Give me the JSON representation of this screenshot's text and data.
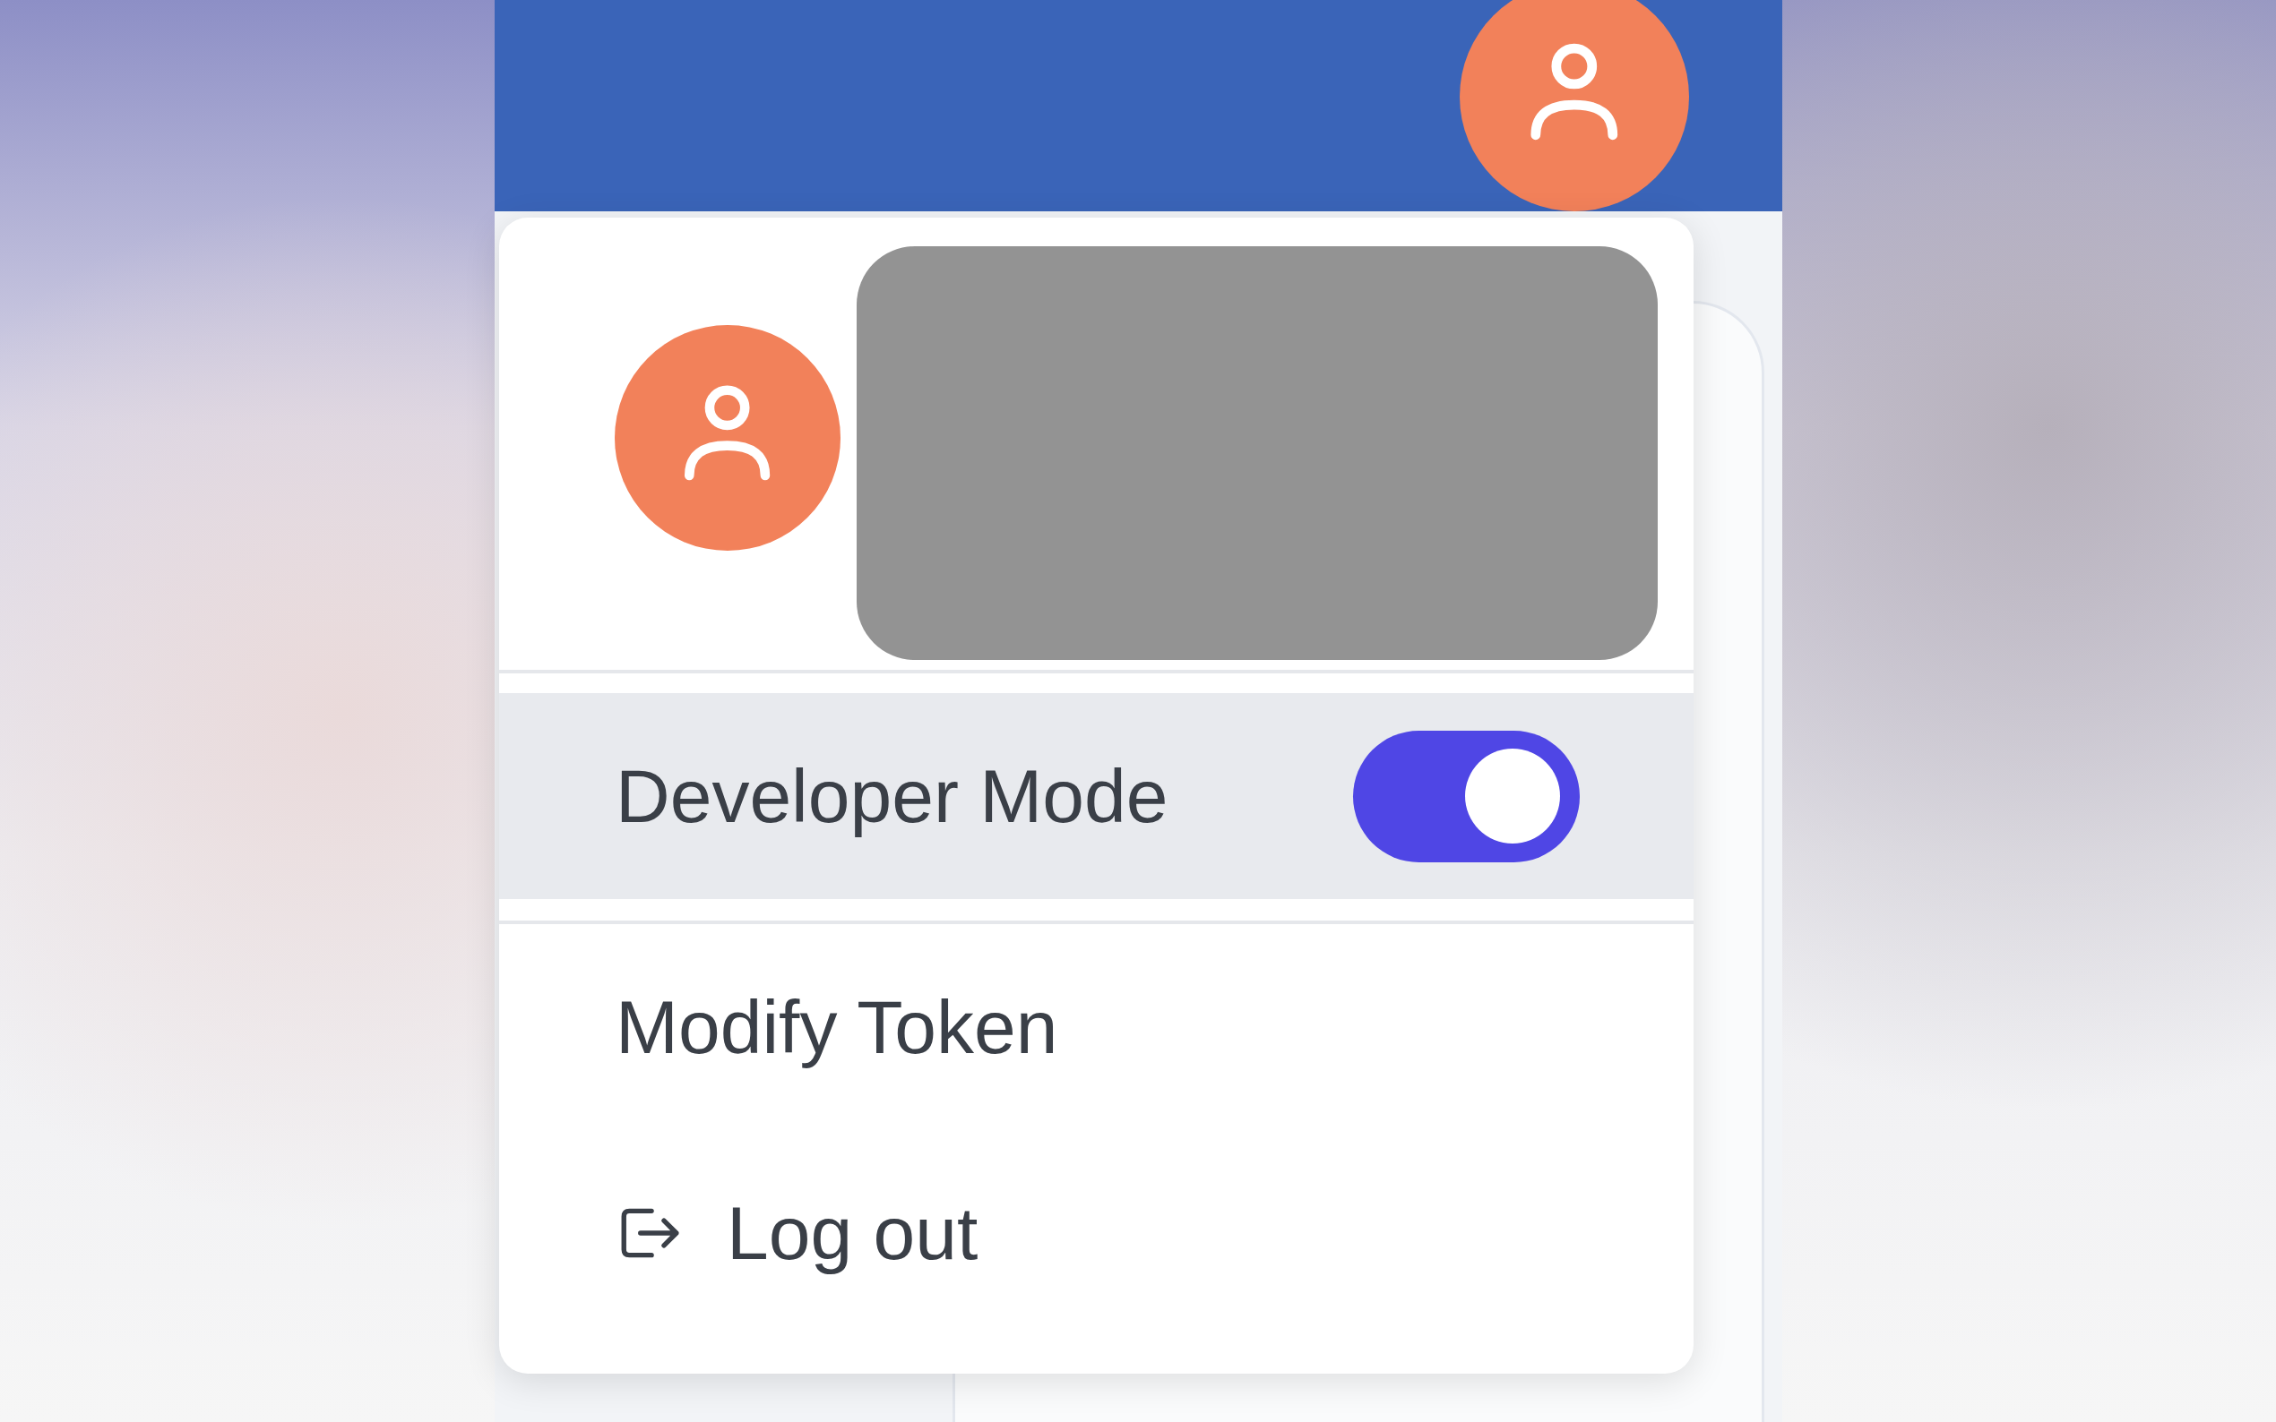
{
  "menu": {
    "items": [
      {
        "kind": "toggle",
        "label": "Developer Mode",
        "on": true,
        "selected": true
      },
      {
        "kind": "plain",
        "label": "Modify Token",
        "selected": false
      },
      {
        "kind": "logout",
        "label": "Log out",
        "selected": false
      }
    ]
  }
}
